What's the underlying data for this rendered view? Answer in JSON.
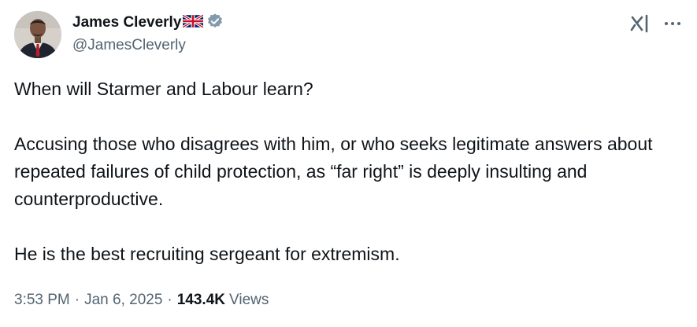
{
  "author": {
    "display_name": "James Cleverly",
    "handle": "@JamesCleverly",
    "flag_icon": "uk-flag-icon",
    "verified_icon": "verified-badge-icon",
    "verified_color": "#829aab"
  },
  "actions": {
    "grok_icon": "grok-icon",
    "more_icon": "more-options-icon"
  },
  "tweet": {
    "paragraphs": [
      "When will Starmer and Labour learn?",
      "Accusing those who disagrees with him, or who seeks legitimate answers about repeated failures of child protection, as “far right” is deeply insulting and counterproductive.",
      "He is the best recruiting sergeant for extremism."
    ]
  },
  "meta": {
    "time": "3:53 PM",
    "separator": "·",
    "date": "Jan 6, 2025",
    "views_count": "143.4K",
    "views_label": "Views"
  },
  "colors": {
    "text_primary": "#0f1419",
    "text_secondary": "#536471",
    "background": "#ffffff"
  }
}
